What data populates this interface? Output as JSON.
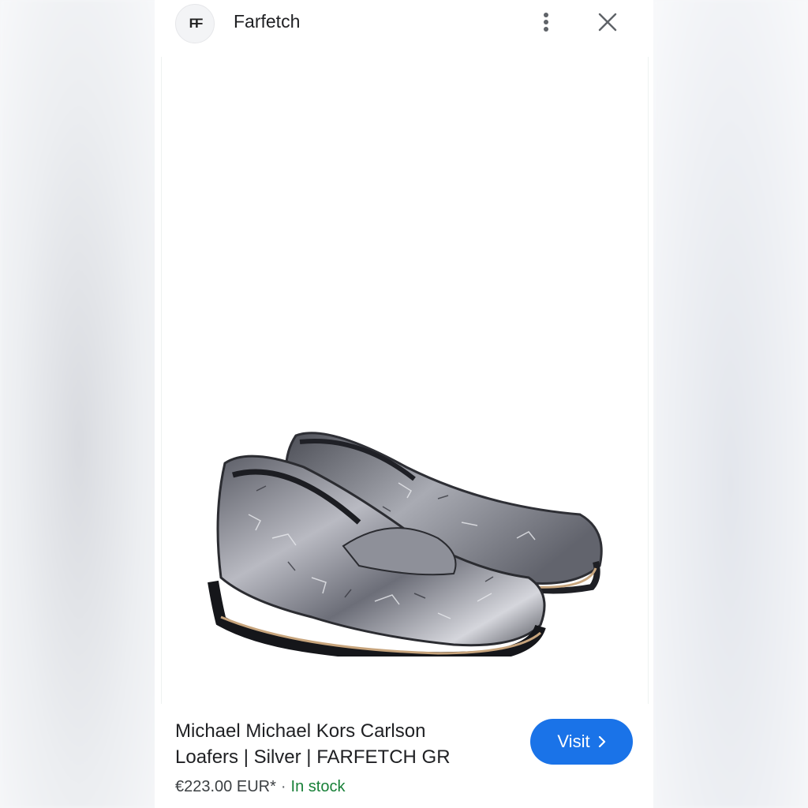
{
  "header": {
    "logo_text": "FF",
    "site_name": "Farfetch",
    "more_icon": "more-vert-icon",
    "close_icon": "close-icon"
  },
  "product": {
    "image_alt": "silver crackled leather penny loafers",
    "title": "Michael Michael Kors Carlson Loafers | Silver | FARFETCH GR",
    "price": "€223.00 EUR*",
    "separator": "·",
    "stock": "In stock"
  },
  "actions": {
    "visit_label": "Visit",
    "visit_icon": "chevron-right-icon"
  },
  "colors": {
    "accent": "#1a73e8",
    "stock_green": "#188038",
    "text": "#202124"
  }
}
